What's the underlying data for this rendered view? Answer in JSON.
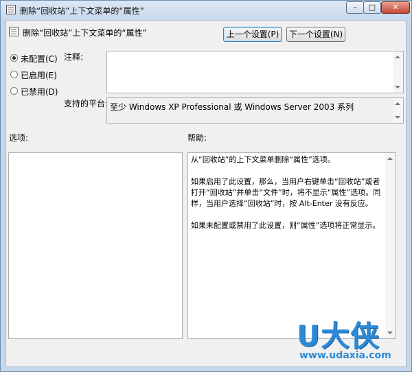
{
  "window": {
    "title": "删除“回收站”上下文菜单的“属性”",
    "controls": {
      "minimize": "–",
      "maximize": "□",
      "close": "✕"
    }
  },
  "header": {
    "policy_title": "删除“回收站”上下文菜单的“属性”",
    "prev_button": "上一个设置(P)",
    "next_button": "下一个设置(N)"
  },
  "state": {
    "options": [
      {
        "label": "未配置(C)",
        "selected": true
      },
      {
        "label": "已启用(E)",
        "selected": false
      },
      {
        "label": "已禁用(D)",
        "selected": false
      }
    ]
  },
  "comment": {
    "label": "注释:",
    "value": ""
  },
  "platform": {
    "label": "支持的平台:",
    "value": "至少 Windows XP Professional 或 Windows Server 2003 系列"
  },
  "options_panel": {
    "label": "选项:"
  },
  "help_panel": {
    "label": "帮助:",
    "paragraphs": [
      "从“回收站”的上下文菜单删除“属性”选项。",
      "如果启用了此设置，那么，当用户右键单击“回收站”或者打开“回收站”并单击“文件”时，将不显示“属性”选项。同样，当用户选择“回收站”时，按 Alt-Enter 没有反应。",
      "如果未配置或禁用了此设置，则“属性”选项将正常显示。"
    ]
  },
  "watermark": {
    "brand": "U大侠",
    "url": "www.udaxia.com"
  }
}
